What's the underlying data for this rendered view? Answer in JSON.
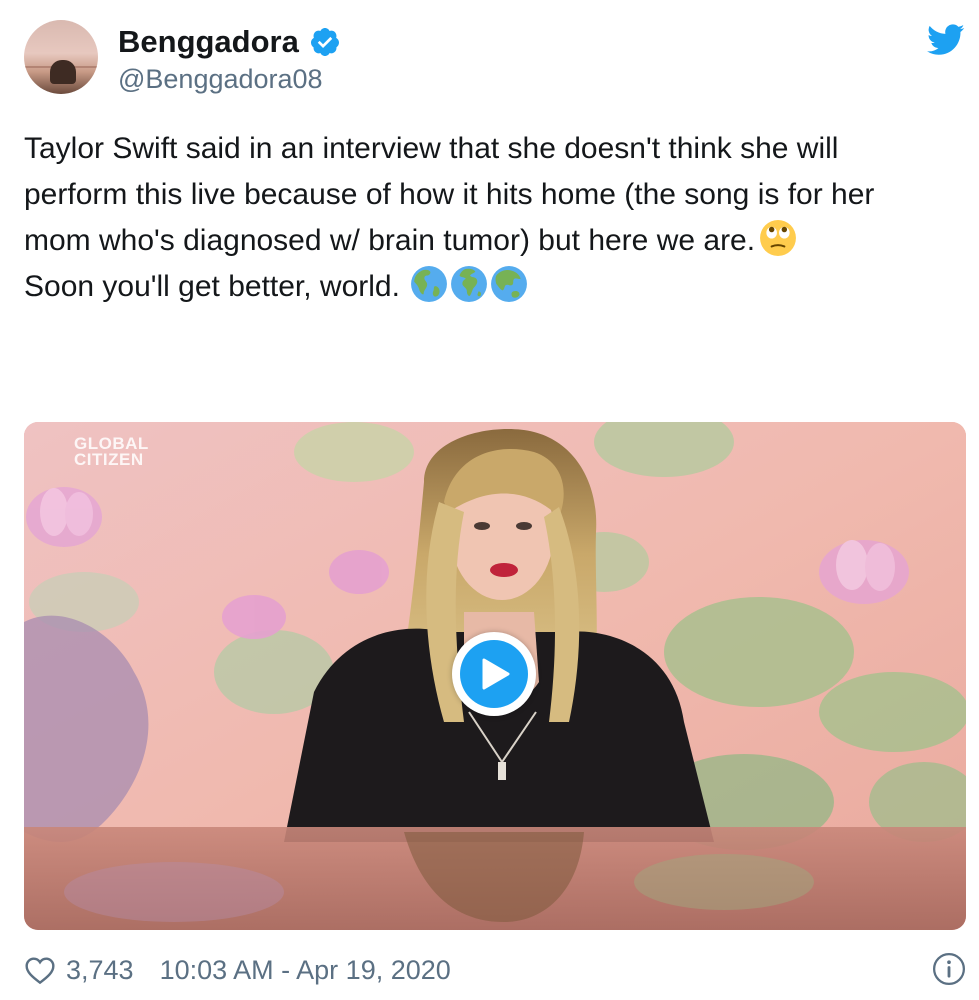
{
  "user": {
    "display_name": "Benggadora",
    "handle": "@Benggadora08",
    "verified": true
  },
  "tweet": {
    "lines": [
      "Taylor Swift said in an interview that she doesn't think she will",
      "perform this live because of how it hits home (the song is for her",
      "mom who's diagnosed w/ brain tumor) but here we are.",
      " Soon you'll get better, world."
    ],
    "emojis": {
      "line3": "face-with-rolling-eyes-emoji",
      "line4": [
        "globe-americas-emoji",
        "globe-africa-europe-emoji",
        "globe-asia-australia-emoji"
      ]
    }
  },
  "media": {
    "watermark_line1": "GLOBAL",
    "watermark_line2": "CITIZEN",
    "type": "video",
    "play_icon": "play-icon"
  },
  "footer": {
    "like_count": "3,743",
    "timestamp": "10:03 AM - Apr 19, 2020",
    "like_icon": "heart-icon",
    "info_icon": "info-icon"
  },
  "brand": {
    "icon": "twitter-bird-icon",
    "color": "#1da1f2"
  },
  "colors": {
    "text_primary": "#14171a",
    "text_secondary": "#5b7083",
    "accent": "#1da1f2"
  }
}
